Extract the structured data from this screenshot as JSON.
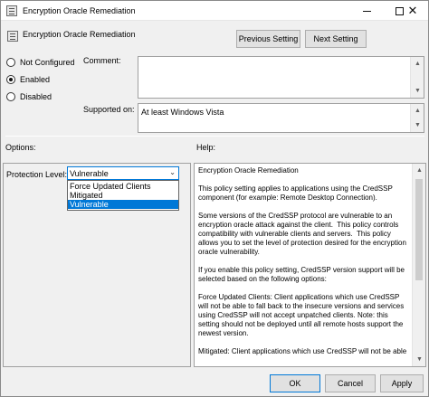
{
  "window": {
    "title": "Encryption Oracle Remediation",
    "minimize_glyph": "",
    "close_glyph": "✕"
  },
  "header": {
    "setting_name": "Encryption Oracle Remediation",
    "previous_label": "Previous Setting",
    "next_label": "Next Setting"
  },
  "state": {
    "options": [
      {
        "label": "Not Configured",
        "checked": false
      },
      {
        "label": "Enabled",
        "checked": true
      },
      {
        "label": "Disabled",
        "checked": false
      }
    ]
  },
  "comment": {
    "label": "Comment:",
    "value": ""
  },
  "supported": {
    "label": "Supported on:",
    "value": "At least Windows Vista"
  },
  "options_section": {
    "label": "Options:",
    "protection_label": "Protection Level:",
    "selected": "Vulnerable",
    "dropdown_items": [
      "Force Updated Clients",
      "Mitigated",
      "Vulnerable"
    ]
  },
  "help_section": {
    "label": "Help:",
    "text": "Encryption Oracle Remediation\n\nThis policy setting applies to applications using the CredSSP component (for example: Remote Desktop Connection).\n\nSome versions of the CredSSP protocol are vulnerable to an encryption oracle attack against the client.  This policy controls compatibility with vulnerable clients and servers.  This policy allows you to set the level of protection desired for the encryption oracle vulnerability.\n\nIf you enable this policy setting, CredSSP version support will be selected based on the following options:\n\nForce Updated Clients: Client applications which use CredSSP will not be able to fall back to the insecure versions and services using CredSSP will not accept unpatched clients. Note: this setting should not be deployed until all remote hosts support the newest version.\n\nMitigated: Client applications which use CredSSP will not be able"
  },
  "footer": {
    "ok_label": "OK",
    "cancel_label": "Cancel",
    "apply_label": "Apply"
  },
  "colors": {
    "accent": "#0078d7",
    "window_bg": "#f0f0f0"
  }
}
